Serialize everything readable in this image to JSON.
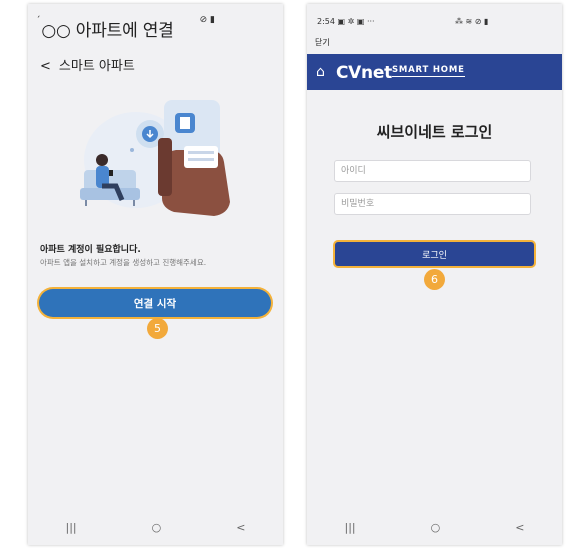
{
  "left_screen": {
    "status_icons": "⊘ ▮",
    "title": "○○ 아파트에 연결",
    "title_tick": "ˊ",
    "back_chevron": "<",
    "back_label": "스마트 아파트",
    "requirement_title": "아파트 계정이 필요합니다.",
    "requirement_desc": "아파트 앱을 설치하고 계정을 생성하고 진행해주세요.",
    "connect_button": "연결 시작",
    "step_badge": "5",
    "nav": {
      "recent": "|||",
      "home": "○",
      "back": "<"
    }
  },
  "right_screen": {
    "status_time": "2:54",
    "status_left_icons": "▣ ✲ ▣ ···",
    "status_right_icons": "⁂ ≋ ⊘ ▮",
    "close_label": "닫기",
    "brand": "CVnet",
    "brand_sub": "SMART HOME",
    "login_title": "씨브이네트 로그인",
    "id_placeholder": "아이디",
    "pw_placeholder": "비밀번호",
    "login_button": "로그인",
    "step_badge": "6",
    "nav": {
      "recent": "|||",
      "home": "○",
      "back": "<"
    }
  },
  "colors": {
    "primary_blue": "#2f73ba",
    "cvnet_navy": "#2a4594",
    "highlight_orange": "#f4b23a",
    "badge_orange": "#f2a93b",
    "screen_bg": "#f1f1f3"
  },
  "icons": [
    "home-icon",
    "back-chevron-icon",
    "recent-apps-icon",
    "home-nav-icon",
    "back-nav-icon",
    "smart-apartment-illustration"
  ]
}
